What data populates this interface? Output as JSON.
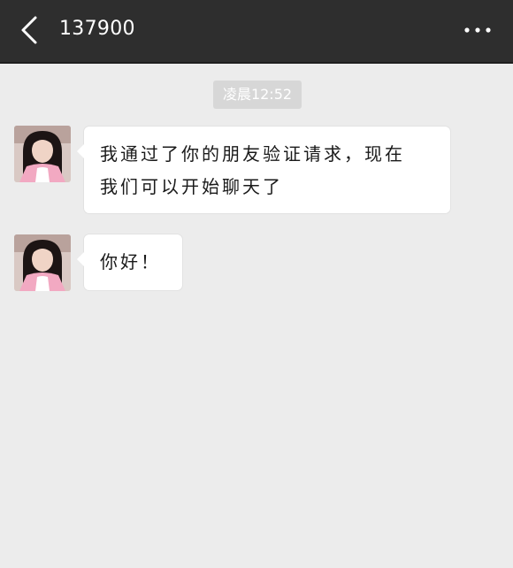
{
  "header": {
    "back_icon": "chevron-left-icon",
    "title": "137900",
    "more_icon": "more-dots-icon",
    "background": "#2e2e2e"
  },
  "chat": {
    "timestamp": "凌晨12:52",
    "messages": [
      {
        "sender": "contact",
        "avatar_icon": "contact-avatar",
        "line1": "我通过了你的朋友验证请求，现在",
        "line2": "我们可以开始聊天了"
      },
      {
        "sender": "contact",
        "avatar_icon": "contact-avatar",
        "text": "你好！"
      }
    ],
    "background": "#ececec",
    "bubble_color": "#ffffff"
  }
}
